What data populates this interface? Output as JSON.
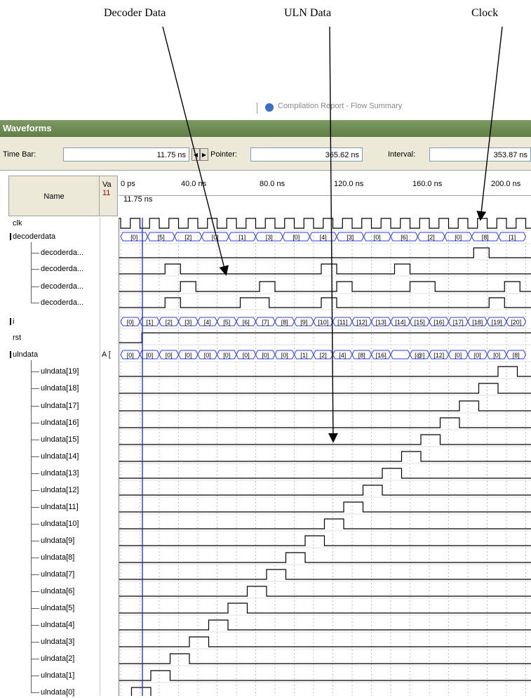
{
  "annotations": {
    "decoder": "Decoder Data",
    "uln": "ULN Data",
    "clock": "Clock"
  },
  "tab": {
    "text": "Compilation Report - Flow Summary"
  },
  "window": {
    "title": "Waveforms"
  },
  "toolbar": {
    "time_bar_label": "Time Bar:",
    "time_bar_value": "11.75 ns",
    "pointer_label": "Pointer:",
    "pointer_value": "365.62 ns",
    "interval_label": "Interval:",
    "interval_value": "353.87 ns"
  },
  "columns": {
    "name": "Name",
    "value": "Va",
    "value2": "11"
  },
  "ruler": {
    "ticks": [
      "0 ps",
      "40.0 ns",
      "80.0 ns",
      "120.0 ns",
      "160.0 ns",
      "200.0 ns"
    ],
    "timebar_tag": "11.75 ns"
  },
  "signals": [
    {
      "name": "clk",
      "value": ""
    },
    {
      "name": "decoderdata",
      "value": ""
    },
    {
      "name": "decoderda...",
      "value": ""
    },
    {
      "name": "decoderda...",
      "value": ""
    },
    {
      "name": "decoderda...",
      "value": ""
    },
    {
      "name": "decoderda...",
      "value": ""
    },
    {
      "name": "i",
      "value": ""
    },
    {
      "name": "rst",
      "value": ""
    },
    {
      "name": "ulndata",
      "value": "A ["
    },
    {
      "name": "ulndata[19]",
      "value": ""
    },
    {
      "name": "ulndata[18]",
      "value": ""
    },
    {
      "name": "ulndata[17]",
      "value": ""
    },
    {
      "name": "ulndata[16]",
      "value": ""
    },
    {
      "name": "ulndata[15]",
      "value": ""
    },
    {
      "name": "ulndata[14]",
      "value": ""
    },
    {
      "name": "ulndata[13]",
      "value": ""
    },
    {
      "name": "ulndata[12]",
      "value": ""
    },
    {
      "name": "ulndata[11]",
      "value": ""
    },
    {
      "name": "ulndata[10]",
      "value": ""
    },
    {
      "name": "ulndata[9]",
      "value": ""
    },
    {
      "name": "ulndata[8]",
      "value": ""
    },
    {
      "name": "ulndata[7]",
      "value": ""
    },
    {
      "name": "ulndata[6]",
      "value": ""
    },
    {
      "name": "ulndata[5]",
      "value": ""
    },
    {
      "name": "ulndata[4]",
      "value": ""
    },
    {
      "name": "ulndata[3]",
      "value": ""
    },
    {
      "name": "ulndata[2]",
      "value": ""
    },
    {
      "name": "ulndata[1]",
      "value": ""
    },
    {
      "name": "ulndata[0]",
      "value": ""
    }
  ],
  "bus_values": {
    "decoderdata": [
      "0",
      "5",
      "2",
      "0",
      "1",
      "3",
      "0",
      "4",
      "3",
      "0",
      "6",
      "2",
      "0",
      "8",
      "1"
    ],
    "i": [
      "0",
      "1",
      "2",
      "3",
      "4",
      "5",
      "6",
      "7",
      "8",
      "9",
      "10",
      "11",
      "12",
      "13",
      "14",
      "15",
      "16",
      "17",
      "18",
      "19",
      "20"
    ],
    "ulndata": [
      "0",
      "0",
      "0",
      "0",
      "0",
      "0",
      "0",
      "0",
      "0",
      "1",
      "2",
      "4",
      "8",
      "16",
      "",
      "@",
      "12",
      "0",
      "0",
      "0",
      "8"
    ]
  },
  "colors": {
    "titlebar": "#6b8b50",
    "wave": "#000000",
    "bus": "#2a3cff",
    "cursor": "#1a2ad0",
    "grid": "#c0c0c0"
  }
}
